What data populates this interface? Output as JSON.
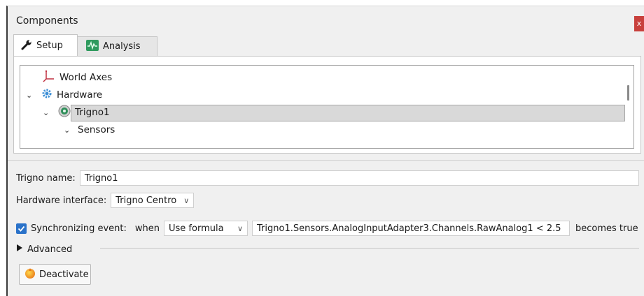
{
  "window": {
    "title": "Components",
    "close_label": "x"
  },
  "tabs": [
    {
      "label": "Setup",
      "icon": "wrench-icon",
      "active": true
    },
    {
      "label": "Analysis",
      "icon": "waveform-icon",
      "active": false
    }
  ],
  "tree": [
    {
      "label": "World Axes",
      "icon": "axes-icon",
      "expanded": null
    },
    {
      "label": "Hardware",
      "icon": "gear-icon",
      "expanded": true
    },
    {
      "label": "Trigno1",
      "icon": "trigno-icon",
      "expanded": true,
      "selected": true
    },
    {
      "label": "Sensors",
      "icon": null,
      "expanded": true
    }
  ],
  "form": {
    "name_label": "Trigno name:",
    "name_value": "Trigno1",
    "interface_label": "Hardware interface:",
    "interface_value": "Trigno Centro",
    "sync_checked": true,
    "sync_label": "Synchronizing event:",
    "when_label": "when",
    "when_value": "Use formula",
    "formula_value": "Trigno1.Sensors.AnalogInputAdapter3.Channels.RawAnalog1 < 2.5",
    "becomes_label": "becomes true",
    "advanced_label": "Advanced",
    "deactivate_label": "Deactivate"
  },
  "colors": {
    "accent": "#2a72c9",
    "close": "#c8403c",
    "selection": "#d9d9d9"
  }
}
